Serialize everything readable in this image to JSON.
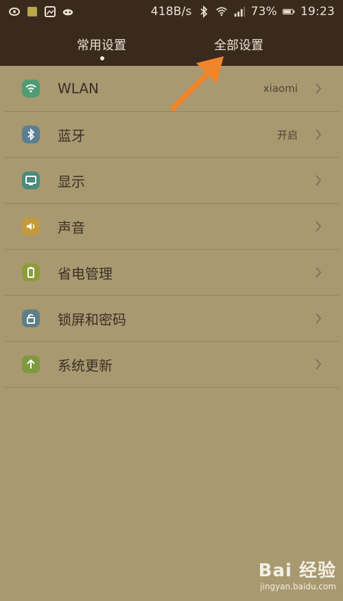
{
  "status_bar": {
    "speed": "418B/s",
    "battery": "73%",
    "time": "19:23"
  },
  "tabs": {
    "common": "常用设置",
    "all": "全部设置"
  },
  "settings": [
    {
      "label": "WLAN",
      "value": "xiaomi",
      "icon": "wifi-icon",
      "color": "#4f9b73"
    },
    {
      "label": "蓝牙",
      "value": "开启",
      "icon": "bluetooth-icon",
      "color": "#5b7f92"
    },
    {
      "label": "显示",
      "value": "",
      "icon": "display-icon",
      "color": "#4a8b7a"
    },
    {
      "label": "声音",
      "value": "",
      "icon": "sound-icon",
      "color": "#c59a3a"
    },
    {
      "label": "省电管理",
      "value": "",
      "icon": "battery-icon",
      "color": "#8d9c3b"
    },
    {
      "label": "锁屏和密码",
      "value": "",
      "icon": "lock-icon",
      "color": "#5e7f87"
    },
    {
      "label": "系统更新",
      "value": "",
      "icon": "update-icon",
      "color": "#7e9a3e"
    }
  ],
  "watermark": {
    "brand": "Bai 经验",
    "url": "jingyan.baidu.com"
  }
}
